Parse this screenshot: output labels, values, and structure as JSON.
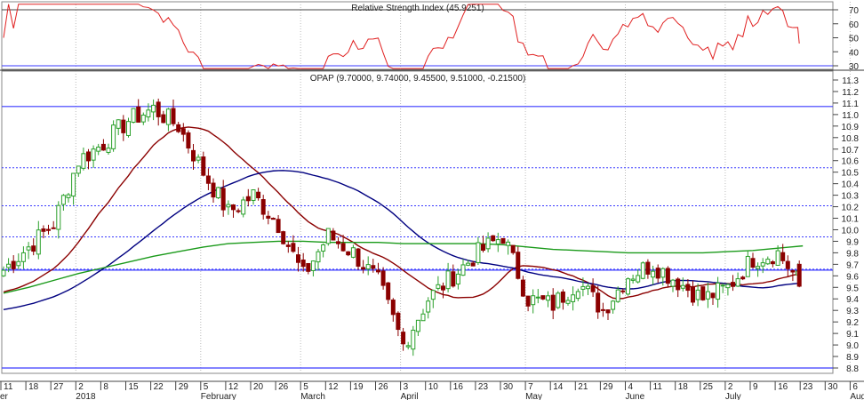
{
  "chart_data": {
    "type": "candlestick",
    "rsi": {
      "title": "Relative Strength Index (45.9251)",
      "ticks": [
        70,
        60,
        50,
        40,
        30
      ],
      "levels": [
        70,
        30
      ],
      "color": "#e02020"
    },
    "price": {
      "title": "OPAP (9.70000, 9.74000, 9.45500, 9.51000, -0.21500)",
      "ticks": [
        11.3,
        11.2,
        11.1,
        11.0,
        10.9,
        10.8,
        10.7,
        10.6,
        10.5,
        10.4,
        10.3,
        10.2,
        10.1,
        10.0,
        9.9,
        9.8,
        9.7,
        9.6,
        9.5,
        9.4,
        9.3,
        9.2,
        9.1,
        9.0,
        8.9,
        8.8
      ],
      "ylim": [
        8.8,
        11.3
      ],
      "solid_levels": [
        11.07,
        9.65,
        8.8
      ],
      "dotted_levels": [
        10.53,
        10.2,
        9.93,
        9.65
      ],
      "weekly_closes": [
        9.65,
        9.85,
        10.05,
        10.6,
        10.75,
        10.95,
        11.05,
        10.9,
        10.5,
        10.15,
        10.3,
        10.05,
        9.6,
        9.95,
        9.8,
        9.55,
        9.0,
        9.4,
        9.6,
        9.8,
        9.95,
        9.4,
        9.35,
        9.55,
        9.3,
        9.6,
        9.7,
        9.55,
        9.4,
        9.5,
        9.75,
        9.8,
        9.51
      ],
      "ma_long_keypoints": [
        9.45,
        9.5,
        9.56,
        9.62,
        9.67,
        9.72,
        9.77,
        9.81,
        9.85,
        9.88,
        9.89,
        9.9,
        9.9,
        9.89,
        9.89,
        9.89,
        9.88,
        9.88,
        9.88,
        9.88,
        9.87,
        9.85,
        9.83,
        9.82,
        9.81,
        9.8,
        9.8,
        9.8,
        9.8,
        9.81,
        9.82,
        9.84,
        9.86
      ],
      "colors": {
        "up": "#2aa02a",
        "down": "#8b0000",
        "ma_short": "#8b0000",
        "ma_mid": "#000080",
        "ma_long": "#1a9a1a",
        "level": "#3a3aff"
      }
    },
    "x_ticks": [
      "11",
      "18",
      "27",
      "2",
      "8",
      "15",
      "22",
      "29",
      "5",
      "12",
      "20",
      "26",
      "5",
      "12",
      "19",
      "26",
      "3",
      "10",
      "16",
      "23",
      "30",
      "7",
      "14",
      "21",
      "29",
      "4",
      "11",
      "18",
      "25",
      "2",
      "9",
      "16",
      "23",
      "30",
      "6"
    ],
    "months": [
      {
        "label": "er",
        "week": 0
      },
      {
        "label": "2018",
        "week": 3
      },
      {
        "label": "February",
        "week": 8
      },
      {
        "label": "March",
        "week": 12
      },
      {
        "label": "April",
        "week": 16
      },
      {
        "label": "May",
        "week": 21
      },
      {
        "label": "June",
        "week": 25
      },
      {
        "label": "July",
        "week": 29
      },
      {
        "label": "Augu",
        "week": 34
      }
    ]
  }
}
